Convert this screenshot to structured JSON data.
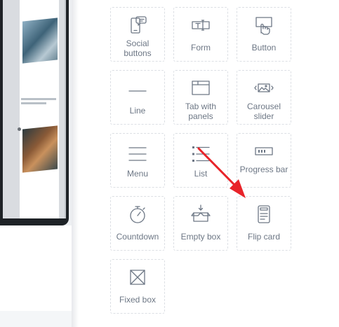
{
  "widgets": [
    {
      "label": "Social buttons",
      "icon": "social-buttons-icon"
    },
    {
      "label": "Form",
      "icon": "form-icon"
    },
    {
      "label": "Button",
      "icon": "button-icon"
    },
    {
      "label": "Line",
      "icon": "line-icon"
    },
    {
      "label": "Tab with panels",
      "icon": "tab-panels-icon"
    },
    {
      "label": "Carousel slider",
      "icon": "carousel-slider-icon"
    },
    {
      "label": "Menu",
      "icon": "menu-icon"
    },
    {
      "label": "List",
      "icon": "list-icon"
    },
    {
      "label": "Progress bar",
      "icon": "progress-bar-icon"
    },
    {
      "label": "Countdown",
      "icon": "countdown-icon"
    },
    {
      "label": "Empty box",
      "icon": "empty-box-icon"
    },
    {
      "label": "Flip card",
      "icon": "flip-card-icon"
    },
    {
      "label": "Fixed box",
      "icon": "fixed-box-icon"
    }
  ],
  "colors": {
    "tile_border": "#dcdfe4",
    "text": "#6d7785",
    "arrow": "#e8242a"
  }
}
